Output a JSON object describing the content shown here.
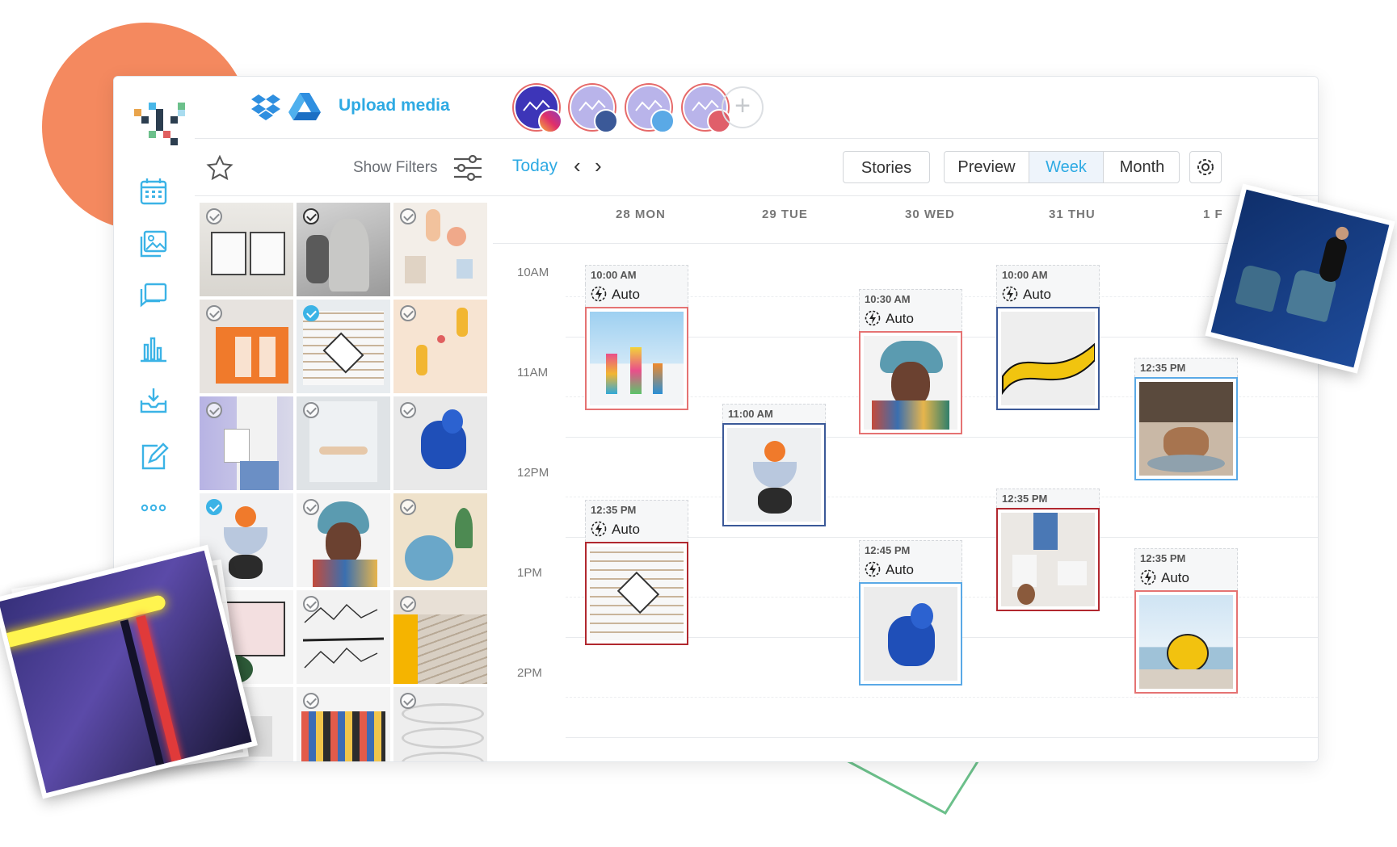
{
  "media_panel": {
    "upload_label": "Upload media",
    "show_filters_label": "Show Filters"
  },
  "accounts": [
    {
      "network": "instagram",
      "icon": "instagram-icon"
    },
    {
      "network": "facebook",
      "icon": "facebook-icon"
    },
    {
      "network": "twitter",
      "icon": "twitter-icon"
    },
    {
      "network": "pinterest",
      "icon": "pinterest-icon"
    }
  ],
  "add_account_label": "+",
  "toolbar": {
    "today_label": "Today",
    "stories_label": "Stories",
    "preview_label": "Preview",
    "week_label": "Week",
    "month_label": "Month"
  },
  "days": [
    "28 MON",
    "29 TUE",
    "30 WED",
    "31 THU",
    "1 F"
  ],
  "hours": [
    "10AM",
    "11AM",
    "12PM",
    "1PM",
    "2PM"
  ],
  "posts": {
    "mon_1": {
      "time": "10:00 AM",
      "auto": "Auto"
    },
    "mon_2": {
      "time": "12:35 PM",
      "auto": "Auto"
    },
    "tue_1": {
      "time": "11:00 AM"
    },
    "wed_1": {
      "time": "10:30 AM",
      "auto": "Auto"
    },
    "wed_2": {
      "time": "12:45 PM",
      "auto": "Auto"
    },
    "thu_1": {
      "time": "10:00 AM",
      "auto": "Auto"
    },
    "thu_2": {
      "time": "12:35 PM"
    },
    "fri_1": {
      "time": "12:35 PM"
    },
    "fri_2": {
      "time": "12:35 PM",
      "auto": "Auto"
    }
  },
  "colors": {
    "accent": "#2eaae3",
    "blob": "#f4895f",
    "instagram": "#e57373",
    "facebook": "#3b5998",
    "twitter": "#5aa9e6",
    "pinterest": "#b1282f"
  }
}
